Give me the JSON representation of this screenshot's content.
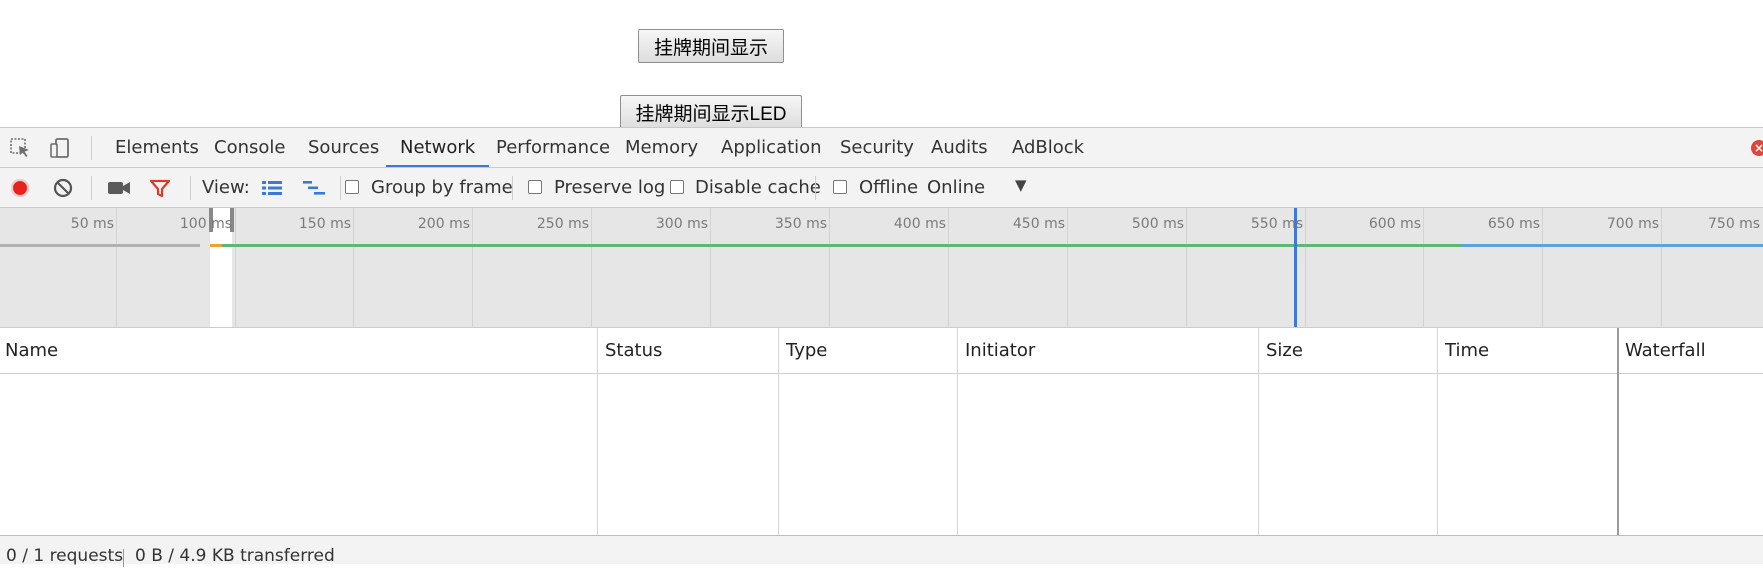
{
  "page": {
    "button_1": "挂牌期间显示",
    "button_2": "挂牌期间显示LED"
  },
  "devtools": {
    "tabs": [
      {
        "label": "Elements",
        "active": false
      },
      {
        "label": "Console",
        "active": false
      },
      {
        "label": "Sources",
        "active": false
      },
      {
        "label": "Network",
        "active": true
      },
      {
        "label": "Performance",
        "active": false
      },
      {
        "label": "Memory",
        "active": false
      },
      {
        "label": "Application",
        "active": false
      },
      {
        "label": "Security",
        "active": false
      },
      {
        "label": "Audits",
        "active": false
      },
      {
        "label": "AdBlock",
        "active": false
      }
    ],
    "close_icon": "close-icon",
    "inspect_icon": "inspect-element-icon",
    "device_icon": "device-toolbar-icon",
    "accent_color": "#3879d9",
    "record_color": "#e8231d"
  },
  "toolbar": {
    "view_label": "View:",
    "group_by_frame": {
      "label": "Group by frame",
      "checked": false
    },
    "preserve_log": {
      "label": "Preserve log",
      "checked": false
    },
    "disable_cache": {
      "label": "Disable cache",
      "checked": false
    },
    "offline": {
      "label": "Offline",
      "checked": false
    },
    "throttling": "Online",
    "icons": [
      "record-icon",
      "clear-icon",
      "capture-screenshots-icon",
      "filter-icon",
      "large-rows-icon",
      "waterfall-overview-icon",
      "dropdown-arrow-icon"
    ]
  },
  "overview": {
    "ticks": [
      "50 ms",
      "100 ms",
      "150 ms",
      "200 ms",
      "250 ms",
      "300 ms",
      "350 ms",
      "400 ms",
      "450 ms",
      "500 ms",
      "550 ms",
      "600 ms",
      "650 ms",
      "700 ms",
      "750 ms"
    ]
  },
  "table": {
    "columns": [
      "Name",
      "Status",
      "Type",
      "Initiator",
      "Size",
      "Time",
      "Waterfall"
    ],
    "rows": []
  },
  "status": {
    "requests": "0 / 1 requests",
    "transferred": "0 B / 4.9 KB transferred"
  }
}
